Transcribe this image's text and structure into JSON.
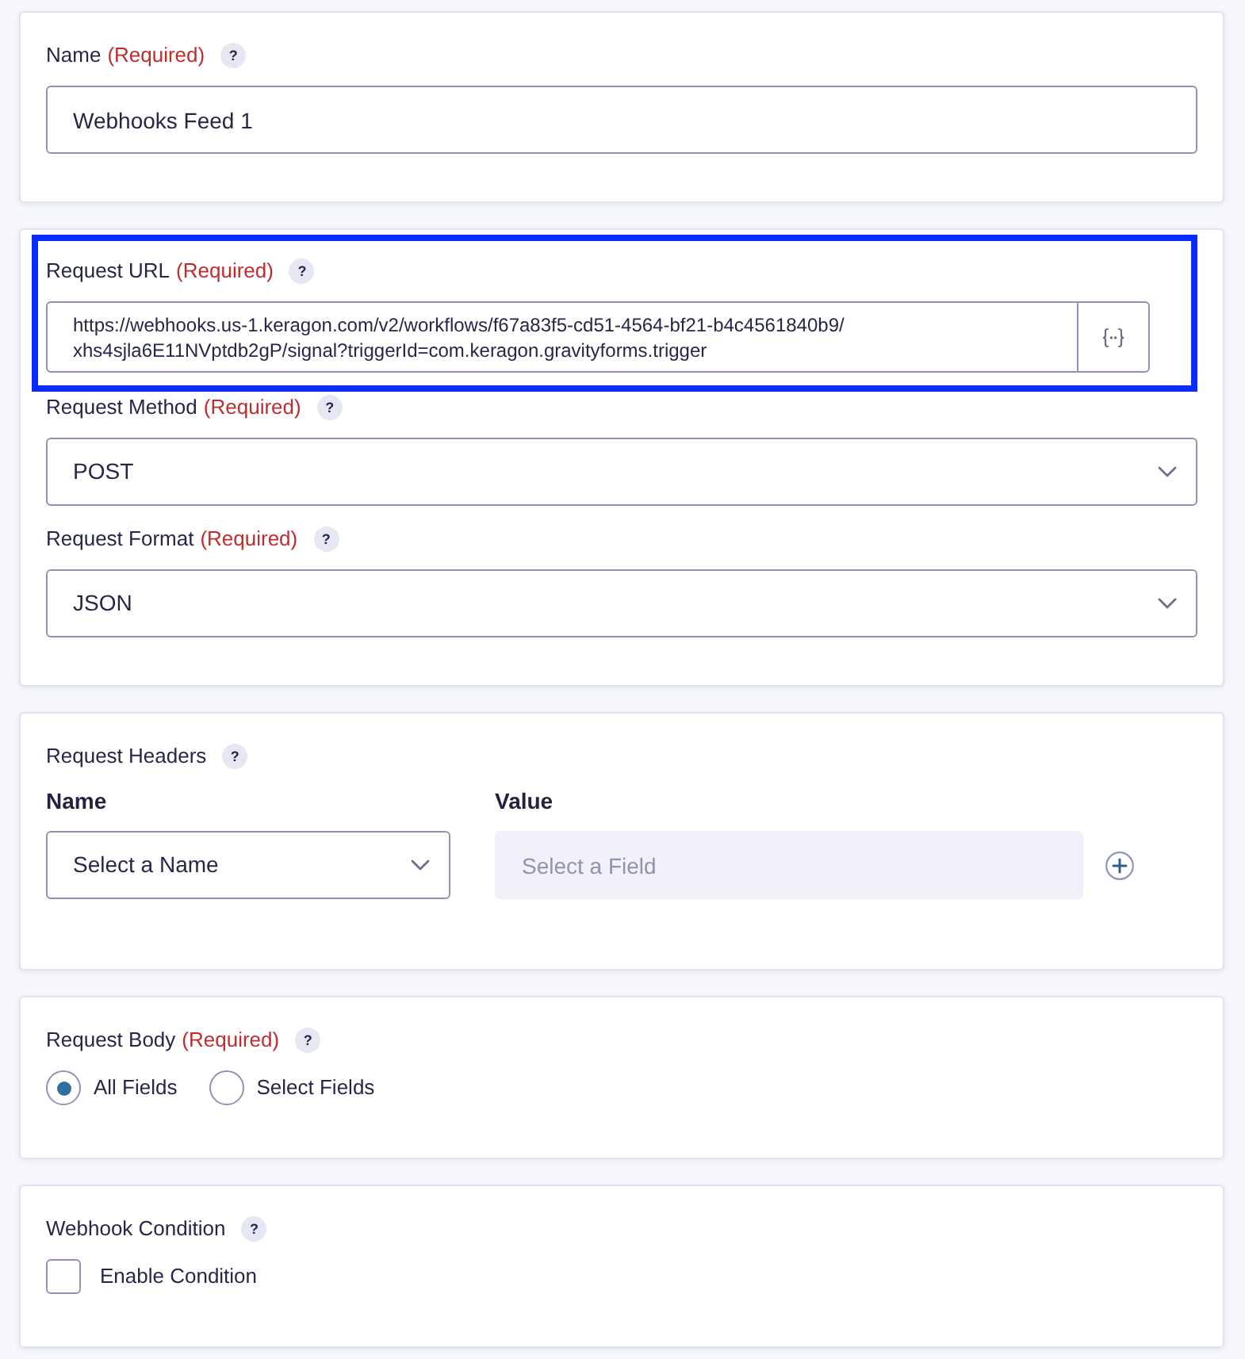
{
  "cards": [
    {
      "fields": [
        {
          "kind": "text",
          "label": "Name",
          "required": "(Required)",
          "help": "?",
          "value": "Webhooks Feed 1"
        }
      ]
    },
    {
      "fields": [
        {
          "kind": "url",
          "label": "Request URL",
          "required": "(Required)",
          "help": "?",
          "value": "https://webhooks.us-1.keragon.com/v2/workflows/f67a83f5-cd51-4564-bf21-b4c4561840b9/xhs4sjla6E11NVptdb2gP/signal?triggerId=com.keragon.gravityforms.trigger",
          "highlighted": true
        },
        {
          "kind": "select",
          "label": "Request Method",
          "required": "(Required)",
          "help": "?",
          "value": "POST"
        },
        {
          "kind": "select",
          "label": "Request Format",
          "required": "(Required)",
          "help": "?",
          "value": "JSON"
        }
      ]
    },
    {
      "fields": [
        {
          "kind": "headers",
          "label": "Request Headers",
          "help": "?",
          "columns": [
            "Name",
            "Value"
          ],
          "rows": [
            {
              "name": "Select a Name",
              "placeholder": "Select a Field"
            }
          ]
        }
      ]
    },
    {
      "fields": [
        {
          "kind": "radio",
          "label": "Request Body",
          "required": "(Required)",
          "help": "?",
          "options": [
            {
              "label": "All Fields",
              "selected": true
            },
            {
              "label": "Select Fields",
              "selected": false
            }
          ]
        }
      ]
    },
    {
      "fields": [
        {
          "kind": "checkbox",
          "label": "Webhook Condition",
          "help": "?",
          "options": [
            {
              "label": "Enable Condition",
              "checked": false
            }
          ]
        }
      ]
    }
  ]
}
